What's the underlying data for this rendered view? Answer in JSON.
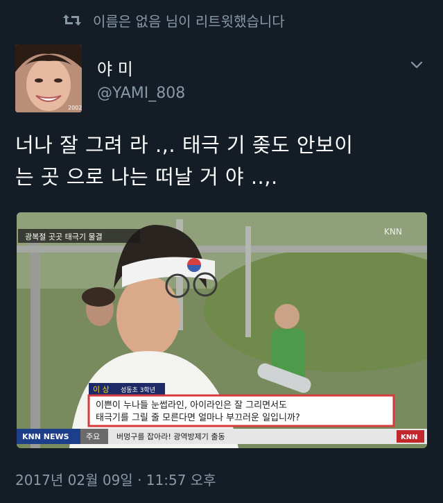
{
  "retweet": {
    "text": "이름은 없음 님이 리트윗했습니다",
    "icon": "retweet-icon"
  },
  "author": {
    "display_name": "야 미",
    "handle": "@YAMI_808",
    "avatar_caption": "2002"
  },
  "tweet": {
    "lines": [
      "너나 잘 그려 라 .,. 태극 기 좆도 안보이",
      "는 곳 으로 나는 떠날 거  야 ..,."
    ]
  },
  "media": {
    "top_left_caption": "광복절 곳곳 태극기 물결",
    "broadcaster_logo": "KNN",
    "name_tag": "이 상",
    "name_tag_sub": "성동초 3학년",
    "subtitle_line1": "이쁜이 누나들 눈썹라인, 아이라인은 잘 그리면서도",
    "subtitle_line2": "태극기를 그릴 줄 모른다면 얼마나 부끄러운 일입니까?",
    "ticker_label": "KNN NEWS",
    "ticker_section": "주요",
    "ticker_text": "버멍구를 잡아라! 광역방제기 출동",
    "ticker_logo": "KNN"
  },
  "timestamp": "2017년 02월 09일 · 11:57 오후",
  "colors": {
    "background": "#141d26",
    "secondary_text": "#8899a6"
  }
}
